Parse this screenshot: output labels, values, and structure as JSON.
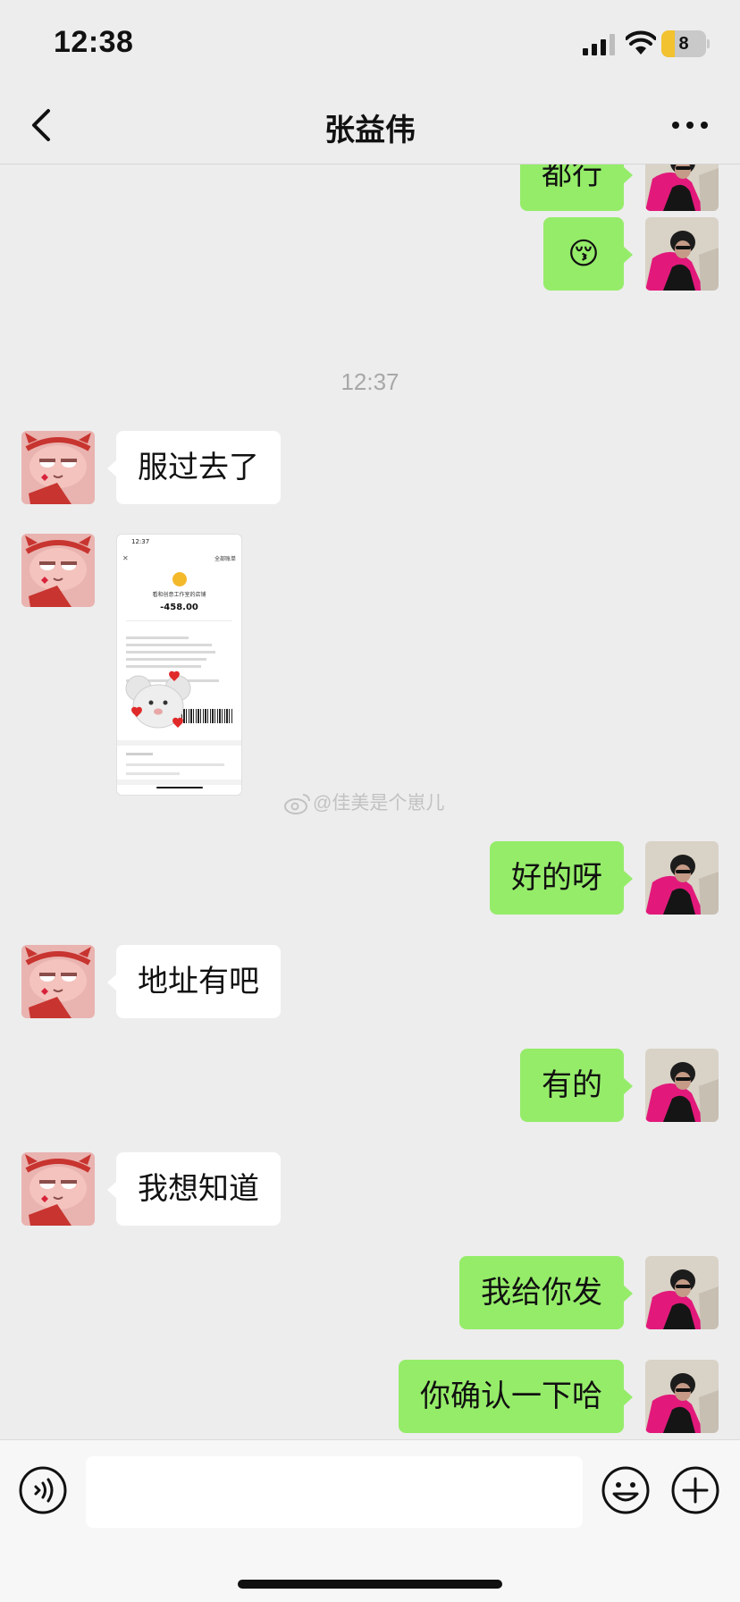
{
  "status_bar": {
    "time": "12:38",
    "battery_level": "8",
    "battery_fraction": 0.3
  },
  "header": {
    "title": "张益伟",
    "back_icon": "chevron-left-icon",
    "more_icon": "ellipsis-icon"
  },
  "messages": [
    {
      "side": "out",
      "type": "text",
      "text": "都行"
    },
    {
      "side": "out",
      "type": "emoji",
      "text": "😚"
    },
    {
      "type": "timestamp",
      "text": "12:37"
    },
    {
      "side": "in",
      "type": "text",
      "text": "服过去了"
    },
    {
      "side": "in",
      "type": "image",
      "image": {
        "status_time": "12:37",
        "top_link": "全部账单",
        "merchant": "看和创意工作室的店铺",
        "amount": "-458.00"
      }
    },
    {
      "side": "out",
      "type": "text",
      "text": "好的呀"
    },
    {
      "side": "in",
      "type": "text",
      "text": "地址有吧"
    },
    {
      "side": "out",
      "type": "text",
      "text": "有的"
    },
    {
      "side": "in",
      "type": "text",
      "text": "我想知道"
    },
    {
      "side": "out",
      "type": "text",
      "text": "我给你发"
    },
    {
      "side": "out",
      "type": "text",
      "text": "你确认一下哈"
    }
  ],
  "watermark": "@佳美是个崽儿",
  "input_bar": {
    "placeholder": "",
    "voice_icon": "voice-icon",
    "emoji_icon": "smiley-icon",
    "plus_icon": "plus-circle-icon"
  },
  "colors": {
    "background": "#ededed",
    "outgoing_bubble": "#95ec69",
    "incoming_bubble": "#ffffff",
    "timestamp": "#a8a8a8"
  }
}
